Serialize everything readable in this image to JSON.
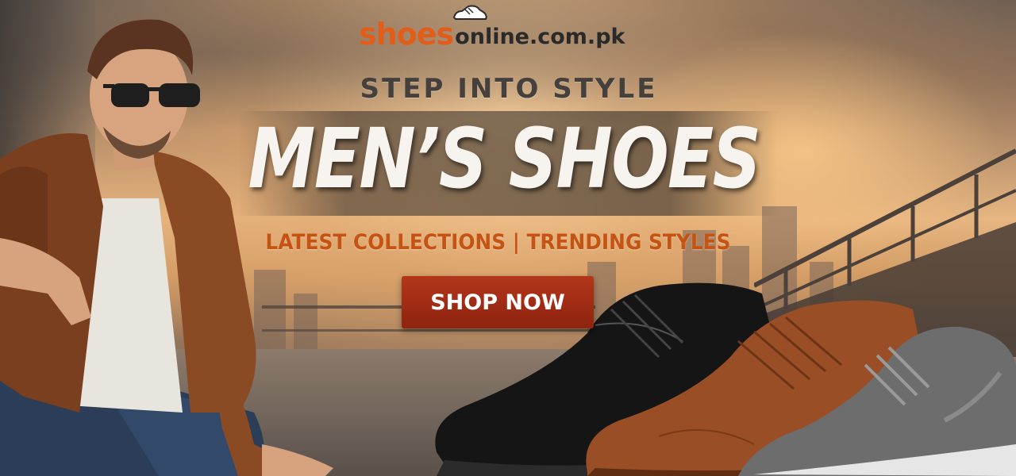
{
  "logo": {
    "brand_part1": "shoes",
    "brand_part2": "online.com.pk",
    "icon": "shoe-icon"
  },
  "hero": {
    "tagline": "STEP INTO STYLE",
    "headline": "MEN’S SHOES",
    "subline": "LATEST COLLECTIONS | TRENDING STYLES",
    "cta_label": "SHOP NOW"
  },
  "colors": {
    "brand_orange": "#e35d1a",
    "brand_dark": "#2a2a2a",
    "cta_red": "#a02c14",
    "subline_orange": "#c45314"
  }
}
